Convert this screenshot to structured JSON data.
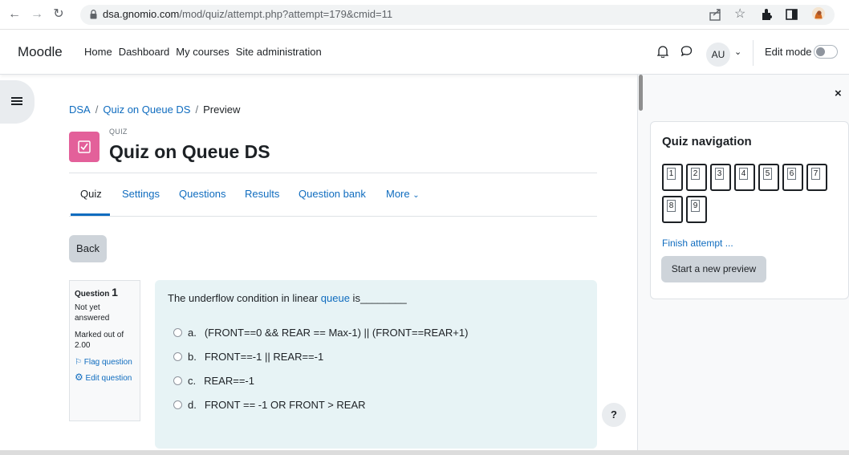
{
  "browser": {
    "url_host": "dsa.gnomio.com",
    "url_path": "/mod/quiz/attempt.php?attempt=179&cmid=11",
    "back_icon": "arrow-left-icon",
    "forward_icon": "arrow-right-icon",
    "reload_icon": "reload-icon"
  },
  "navbar": {
    "brand": "Moodle",
    "links": [
      "Home",
      "Dashboard",
      "My courses",
      "Site administration"
    ],
    "avatar": "AU",
    "edit_mode_label": "Edit mode"
  },
  "breadcrumb": {
    "items": [
      "DSA",
      "Quiz on Queue DS",
      "Preview"
    ],
    "separator": "/"
  },
  "module": {
    "type_label": "QUIZ",
    "title": "Quiz on Queue DS",
    "icon_color": "#e3609a"
  },
  "secondary_nav": {
    "tabs": [
      "Quiz",
      "Settings",
      "Questions",
      "Results",
      "Question bank",
      "More"
    ],
    "active": "Quiz"
  },
  "back_button": "Back",
  "question": {
    "label": "Question",
    "number": "1",
    "state": "Not yet answered",
    "marked_out_of": "Marked out of 2.00",
    "flag": "Flag question",
    "edit": "Edit question",
    "text_before": "The underflow condition in linear ",
    "text_keyword": "queue",
    "text_after": " is________",
    "options": [
      {
        "letter": "a.",
        "text": "(FRONT==0 && REAR == Max-1) || (FRONT==REAR+1)"
      },
      {
        "letter": "b.",
        "text": "FRONT==-1 || REAR==-1"
      },
      {
        "letter": "c.",
        "text": "REAR==-1"
      },
      {
        "letter": "d.",
        "text": "FRONT == -1 OR FRONT > REAR"
      }
    ]
  },
  "help_button": "?",
  "drawer": {
    "close": "×",
    "quiz_nav_title": "Quiz navigation",
    "question_numbers": [
      "1",
      "2",
      "3",
      "4",
      "5",
      "6",
      "7",
      "8",
      "9"
    ],
    "finish_attempt": "Finish attempt ...",
    "start_new_preview": "Start a new preview"
  },
  "colors": {
    "link": "#0f6cbf",
    "question_bg": "#e7f3f5",
    "button_bg": "#ced4da"
  }
}
